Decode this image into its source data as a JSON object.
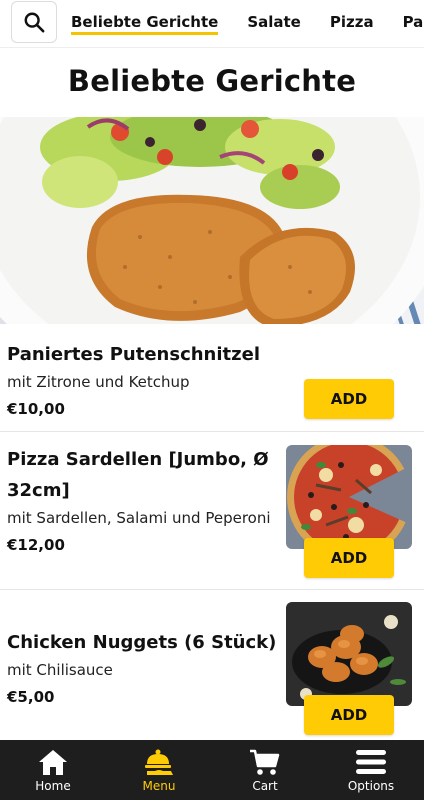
{
  "categories": {
    "tabs": [
      {
        "label": "Beliebte Gerichte",
        "active": true
      },
      {
        "label": "Salate",
        "active": false
      },
      {
        "label": "Pizza",
        "active": false
      },
      {
        "label": "Pasta",
        "active": false
      }
    ]
  },
  "page": {
    "title": "Beliebte Gerichte"
  },
  "dishes": [
    {
      "name": "Paniertes Putenschnitzel",
      "description": "mit Zitrone und Ketchup",
      "price": "€10,00",
      "add_label": "ADD"
    },
    {
      "name": "Pizza Sardellen [Jumbo, Ø 32cm]",
      "description": "mit Sardellen, Salami und Peperoni",
      "price": "€12,00",
      "add_label": "ADD"
    },
    {
      "name": "Chicken Nuggets (6 Stück)",
      "description": "mit Chilisauce",
      "price": "€5,00",
      "add_label": "ADD"
    }
  ],
  "bottom_nav": [
    {
      "label": "Home",
      "icon": "home-icon",
      "active": false
    },
    {
      "label": "Menu",
      "icon": "menu-cloche-icon",
      "active": true
    },
    {
      "label": "Cart",
      "icon": "cart-icon",
      "active": false
    },
    {
      "label": "Options",
      "icon": "hamburger-icon",
      "active": false
    }
  ],
  "colors": {
    "accent": "#ffcb05",
    "nav_bg": "#1e1e1e"
  }
}
